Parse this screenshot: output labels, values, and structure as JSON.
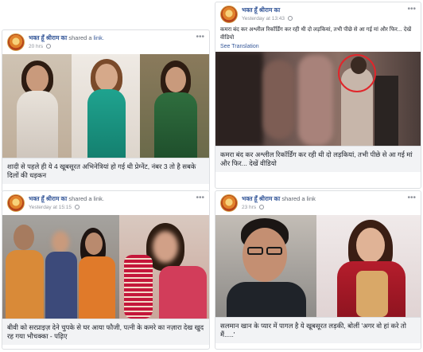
{
  "posts": [
    {
      "page_name": "भक्त हूँ श्रीराम का",
      "action": "shared a",
      "link_word": "link.",
      "time": "20 hrs",
      "caption": "शादी से पहले ही ये 4 खूबसूरत अभिनेत्रियां हो गई थी प्रेग्नेंट, नंबर 3 तो है सबके दिलों की धड़कन"
    },
    {
      "page_name": "भक्त हूँ श्रीराम का",
      "time": "Yesterday at 13:43",
      "text": "कमरा बंद कर अश्लील रिकॉर्डिंग कर रही थी दो लड़कियां, तभी पीछे से आ गई मां और फिर... देखें वीडियो",
      "see_translation": "See Translation",
      "caption": "कमरा बंद कर अश्लील रिकॉर्डिंग कर रही थी दो लड़कियां, तभी पीछे से आ गई मां और फिर... देखें वीडियो"
    },
    {
      "page_name": "भक्त हूँ श्रीराम का",
      "action": "shared a link.",
      "time": "Yesterday at 15:15",
      "caption": "बीवी को सरप्राइज़ देने चुपके से घर आया फौजी, पत्नी के कमरे का नज़ारा देख खुद रह गया भौचक्का - पढ़िए"
    },
    {
      "page_name": "भक्त हूँ श्रीराम का",
      "action": "shared a link",
      "time": "23 hrs",
      "caption": "सलमान खान के प्यार में पागल है ये खूबसूरत लड़की, बोलीं 'अगर वो हां करे तो मैं.....'"
    }
  ],
  "icons": {
    "avatar": "deity-avatar-icon",
    "privacy": "globe-icon",
    "menu": "more-options-icon",
    "highlight": "red-circle-highlight"
  },
  "colors": {
    "link_blue": "#365899",
    "meta_gray": "#90949c",
    "caption_bg": "#f2f3f5",
    "border": "#dddfe2",
    "highlight_red": "#e0262b"
  }
}
